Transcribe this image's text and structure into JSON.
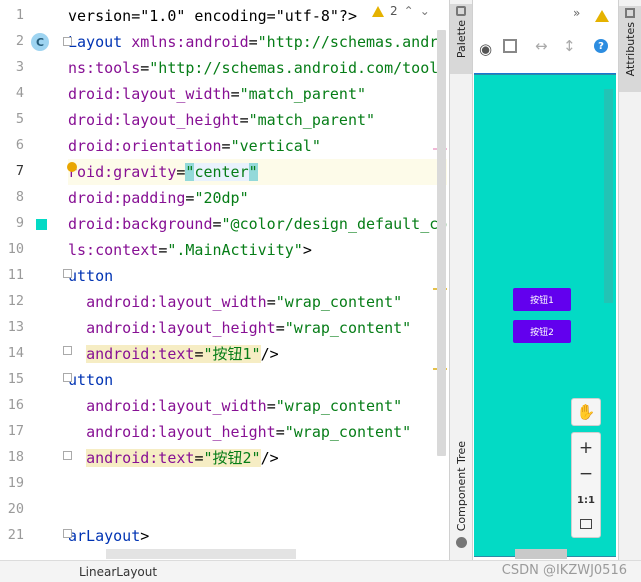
{
  "editor": {
    "lines": [
      {
        "n": "1",
        "parts": [
          [
            "tk-txt",
            "version=\"1.0\" encoding=\"utf-8\"?>"
          ]
        ]
      },
      {
        "n": "2",
        "parts": [
          [
            "tk-tag",
            "Layout "
          ],
          [
            "tk-attr",
            "xmlns:android"
          ],
          [
            "tk-txt",
            "="
          ],
          [
            "tk-str",
            "\"http://schemas.andr"
          ]
        ]
      },
      {
        "n": "3",
        "parts": [
          [
            "tk-attr",
            "ns:tools"
          ],
          [
            "tk-txt",
            "="
          ],
          [
            "tk-str",
            "\"http://schemas.android.com/tool"
          ]
        ]
      },
      {
        "n": "4",
        "parts": [
          [
            "tk-attr",
            "droid:layout_width"
          ],
          [
            "tk-txt",
            "="
          ],
          [
            "tk-str",
            "\"match_parent\""
          ]
        ]
      },
      {
        "n": "5",
        "parts": [
          [
            "tk-attr",
            "droid:layout_height"
          ],
          [
            "tk-txt",
            "="
          ],
          [
            "tk-str",
            "\"match_parent\""
          ]
        ]
      },
      {
        "n": "6",
        "parts": [
          [
            "tk-attr",
            "droid:orientation"
          ],
          [
            "tk-txt",
            "="
          ],
          [
            "tk-str",
            "\"vertical\""
          ]
        ]
      },
      {
        "n": "7",
        "parts": [
          [
            "tk-attr",
            "roid:gravity"
          ],
          [
            "tk-txt",
            "="
          ],
          [
            "tk-str tk-br",
            "\""
          ],
          [
            "tk-str tk-sel",
            "center"
          ],
          [
            "tk-str tk-br",
            "\""
          ]
        ]
      },
      {
        "n": "8",
        "parts": [
          [
            "tk-attr",
            "droid:padding"
          ],
          [
            "tk-txt",
            "="
          ],
          [
            "tk-str",
            "\"20dp\""
          ]
        ]
      },
      {
        "n": "9",
        "parts": [
          [
            "tk-attr",
            "droid:background"
          ],
          [
            "tk-txt",
            "="
          ],
          [
            "tk-str",
            "\"@color/design_default_co"
          ]
        ]
      },
      {
        "n": "10",
        "parts": [
          [
            "tk-attr",
            "ls:context"
          ],
          [
            "tk-txt",
            "="
          ],
          [
            "tk-str",
            "\".MainActivity\""
          ],
          [
            "tk-txt",
            ">"
          ]
        ]
      },
      {
        "n": "11",
        "parts": [
          [
            "tk-tag",
            "utton"
          ]
        ]
      },
      {
        "n": "12",
        "parts": [
          [
            "tk-txt",
            "  "
          ],
          [
            "tk-attr",
            "android:layout_width"
          ],
          [
            "tk-txt",
            "="
          ],
          [
            "tk-str",
            "\"wrap_content\""
          ]
        ]
      },
      {
        "n": "13",
        "parts": [
          [
            "tk-txt",
            "  "
          ],
          [
            "tk-attr",
            "android:layout_height"
          ],
          [
            "tk-txt",
            "="
          ],
          [
            "tk-str",
            "\"wrap_content\""
          ]
        ]
      },
      {
        "n": "14",
        "parts": [
          [
            "tk-txt",
            "  "
          ],
          [
            "tk-attr tk-hlbg",
            "android:text"
          ],
          [
            "tk-txt tk-hlbg",
            "="
          ],
          [
            "tk-str tk-hlbg",
            "\"按钮1\""
          ],
          [
            "tk-txt",
            "/>"
          ]
        ]
      },
      {
        "n": "15",
        "parts": [
          [
            "tk-tag",
            "utton"
          ]
        ]
      },
      {
        "n": "16",
        "parts": [
          [
            "tk-txt",
            "  "
          ],
          [
            "tk-attr",
            "android:layout_width"
          ],
          [
            "tk-txt",
            "="
          ],
          [
            "tk-str",
            "\"wrap_content\""
          ]
        ]
      },
      {
        "n": "17",
        "parts": [
          [
            "tk-txt",
            "  "
          ],
          [
            "tk-attr",
            "android:layout_height"
          ],
          [
            "tk-txt",
            "="
          ],
          [
            "tk-str",
            "\"wrap_content\""
          ]
        ]
      },
      {
        "n": "18",
        "parts": [
          [
            "tk-txt",
            "  "
          ],
          [
            "tk-attr tk-hlbg",
            "android:text"
          ],
          [
            "tk-txt tk-hlbg",
            "="
          ],
          [
            "tk-str tk-hlbg",
            "\"按钮2\""
          ],
          [
            "tk-txt",
            "/>"
          ]
        ]
      },
      {
        "n": "19",
        "parts": []
      },
      {
        "n": "20",
        "parts": []
      },
      {
        "n": "21",
        "parts": [
          [
            "tk-tag",
            "arLayout"
          ],
          [
            "tk-txt",
            ">"
          ]
        ]
      }
    ],
    "current_line": "7",
    "warning_count": "2",
    "class_badge": "C"
  },
  "side_tabs": {
    "palette": "Palette",
    "component_tree": "Component Tree",
    "attributes": "Attributes"
  },
  "preview": {
    "background_color": "#03dac5",
    "button_color": "#6200ee",
    "button1": "按钮1",
    "button2": "按钮2",
    "zoom_actual": "1:1"
  },
  "status": {
    "breadcrumb": "LinearLayout",
    "watermark": "CSDN @IKZWJ0516"
  }
}
